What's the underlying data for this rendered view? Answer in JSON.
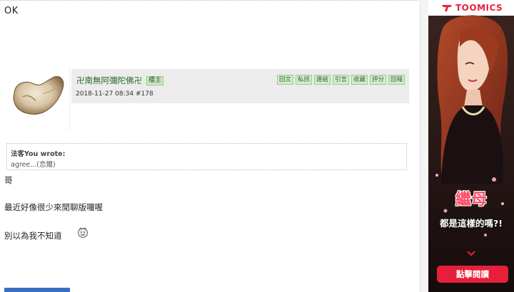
{
  "previous_post": {
    "text": "OK"
  },
  "post": {
    "username": "卍南無阿彌陀佛卍",
    "role_badge": "樓主",
    "date_and_floor": "2018-11-27 08:34  #178",
    "actions": [
      "回文",
      "私訊",
      "連結",
      "引言",
      "收藏",
      "評分",
      "回報"
    ],
    "quote": {
      "author": "法客You wrote:",
      "text": "agree...(恋爾)"
    },
    "lines": [
      "哥",
      "最近好像很少來閒聊版囉喔",
      "別以為我不知道"
    ],
    "smiley_icon": "smug-face-emoticon"
  },
  "ad": {
    "brand": "TOOMICS",
    "title": "繼母",
    "subtitle": "都是這樣的嗎?!",
    "cta": "點擊閱讀",
    "accent_color": "#e81f3a"
  },
  "colors": {
    "post_header_bg": "#ececec",
    "username_color": "#2a6a2a",
    "action_button_bg": "#d6ead0"
  }
}
